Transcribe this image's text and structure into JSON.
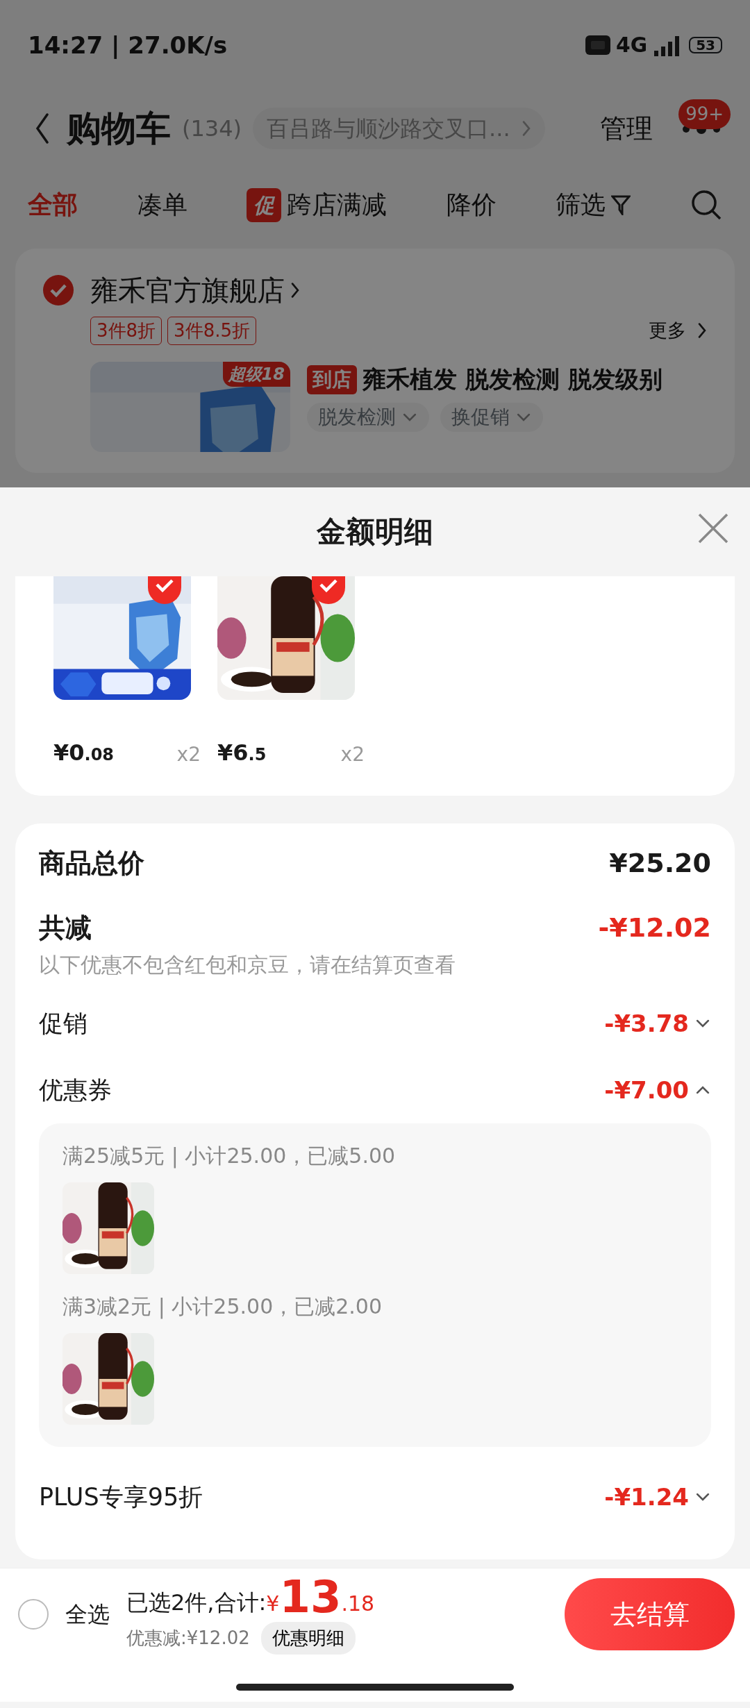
{
  "status_bar": {
    "time": "14:27 | 27.0K/s",
    "network": "4G",
    "battery": "53"
  },
  "header": {
    "title": "购物车",
    "count": "(134)",
    "address": "百吕路与顺沙路交叉口...",
    "manage": "管理",
    "badge": "99+"
  },
  "filter_tabs": [
    {
      "label": "全部",
      "selected": true
    },
    {
      "label": "凑单",
      "selected": false
    },
    {
      "label": "跨店满减",
      "selected": false,
      "tag": "促"
    },
    {
      "label": "降价",
      "selected": false
    },
    {
      "label": "筛选",
      "selected": false
    }
  ],
  "store": {
    "name": "雍禾官方旗舰店",
    "checked": true,
    "promo_tags": [
      "3件8折",
      "3件8.5折"
    ],
    "more": "更多",
    "product": {
      "tag": "到店",
      "title": "雍禾植发 脱发检测 脱发级别",
      "image_badge": "超级18",
      "options": [
        "脱发检测",
        "换促销"
      ]
    }
  },
  "sheet": {
    "title": "金额明细",
    "items": [
      {
        "price_int": "¥0",
        "price_dec": ".08",
        "qty": "x2",
        "selected": true
      },
      {
        "price_int": "¥6",
        "price_dec": ".5",
        "qty": "x2",
        "selected": true
      }
    ],
    "total_label": "商品总价",
    "total": "¥25.20",
    "discount_label": "共减",
    "discount": "-¥12.02",
    "note": "以下优惠不包含红包和京豆，请在结算页查看",
    "rows": [
      {
        "label": "促销",
        "amount": "-¥3.78",
        "expanded": false
      },
      {
        "label": "优惠券",
        "amount": "-¥7.00",
        "expanded": true,
        "details": [
          {
            "text": "满25减5元 | 小计25.00，已减5.00"
          },
          {
            "text": "满3减2元 | 小计25.00，已减2.00"
          }
        ]
      },
      {
        "label": "PLUS专享95折",
        "amount": "-¥1.24",
        "expanded": false
      }
    ]
  },
  "bottom_bar": {
    "select_all": "全选",
    "checked": false,
    "selected_text": "已选2件,合计:",
    "currency": "¥",
    "total_int": "13",
    "total_dec": ".18",
    "saved": "优惠减:¥12.02",
    "detail_button": "优惠明细",
    "checkout": "去结算"
  }
}
